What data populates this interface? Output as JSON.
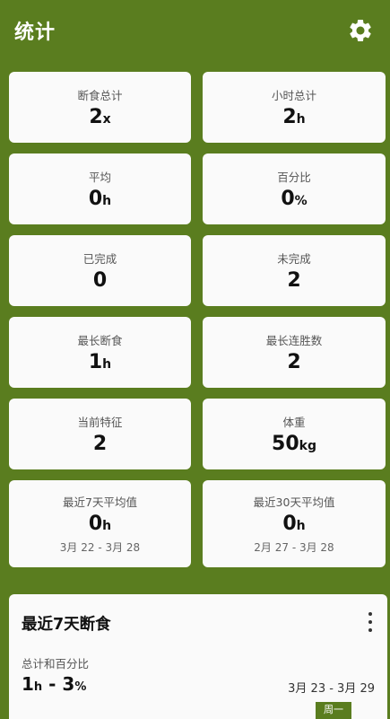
{
  "appbar": {
    "title": "统计",
    "settings_icon": "gear-icon"
  },
  "cards": [
    {
      "label": "断食总计",
      "value": "2",
      "unit": "x"
    },
    {
      "label": "小时总计",
      "value": "2",
      "unit": "h"
    },
    {
      "label": "平均",
      "value": "0",
      "unit": "h"
    },
    {
      "label": "百分比",
      "value": "0",
      "unit": "%"
    },
    {
      "label": "已完成",
      "value": "0",
      "unit": ""
    },
    {
      "label": "未完成",
      "value": "2",
      "unit": ""
    },
    {
      "label": "最长断食",
      "value": "1",
      "unit": "h"
    },
    {
      "label": "最长连胜数",
      "value": "2",
      "unit": ""
    },
    {
      "label": "当前特征",
      "value": "2",
      "unit": ""
    },
    {
      "label": "体重",
      "value": "50",
      "unit": "kg"
    },
    {
      "label": "最近7天平均值",
      "value": "0",
      "unit": "h",
      "range": "3月 22 - 3月 28"
    },
    {
      "label": "最近30天平均值",
      "value": "0",
      "unit": "h",
      "range": "2月 27 - 3月 28"
    }
  ],
  "panel": {
    "title": "最近7天断食",
    "subtitle": "总计和百分比",
    "value_hours": "1",
    "unit_hours": "h",
    "separator": " - ",
    "value_percent": "3",
    "unit_percent": "%",
    "range": "3月 23 - 3月 29",
    "day_label": "周一",
    "menu_icon": "more-vert-icon"
  },
  "colors": {
    "primary": "#5a7d1f",
    "card": "#fafafa"
  }
}
